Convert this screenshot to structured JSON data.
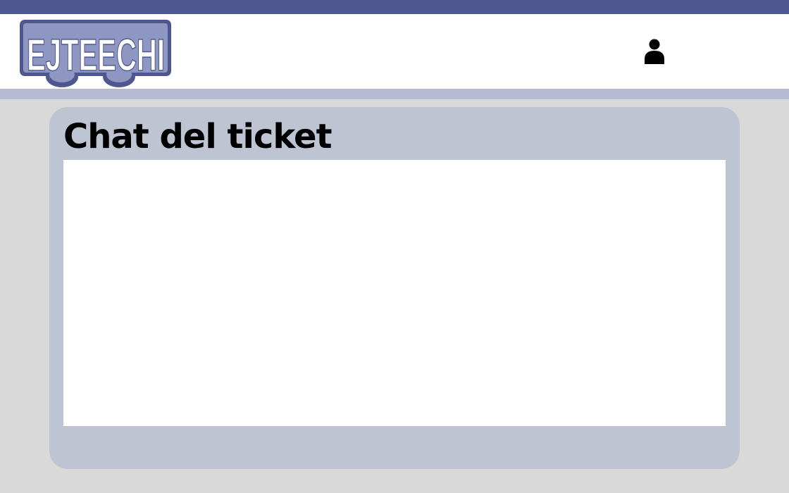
{
  "app": {
    "logo_text": "EJTEECHI"
  },
  "colors": {
    "top_strip": "#4f5790",
    "header_bg": "#ffffff",
    "header_rule": "#b4bbd2",
    "page_bg": "#d9d9d9",
    "panel_bg": "#bfc4d2",
    "logo_fill": "#8e97c2",
    "logo_stroke": "#4f5790"
  },
  "header": {
    "user_icon": "user-icon"
  },
  "chat": {
    "title": "Chat del ticket",
    "messages": []
  }
}
